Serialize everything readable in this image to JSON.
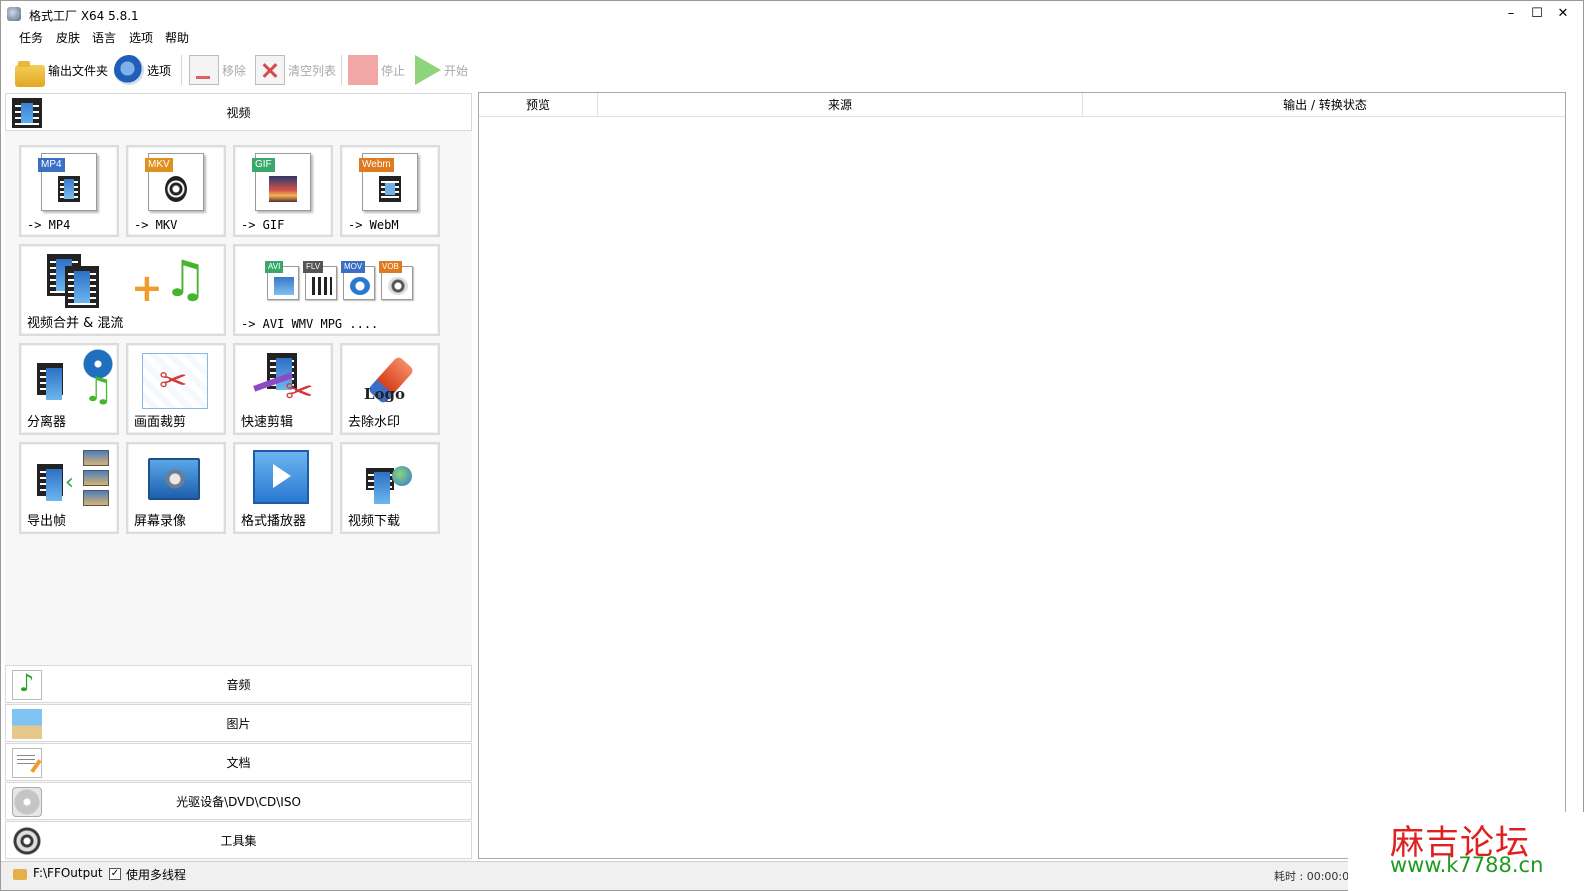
{
  "window": {
    "title": "格式工厂 X64 5.8.1",
    "min_glyph": "–",
    "max_glyph": "☐",
    "close_glyph": "✕"
  },
  "menu": {
    "items": [
      "任务",
      "皮肤",
      "语言",
      "选项",
      "帮助"
    ]
  },
  "toolbar": {
    "output_folder": "输出文件夹",
    "options": "选项",
    "remove": "移除",
    "clear_list": "清空列表",
    "stop": "停止",
    "start": "开始"
  },
  "categories": {
    "video": "视频",
    "audio": "音频",
    "image": "图片",
    "document": "文档",
    "disc": "光驱设备\\DVD\\CD\\ISO",
    "tools": "工具集"
  },
  "tools": {
    "mp4": {
      "label": "-> MP4",
      "tag": "MP4",
      "tag_color": "#3a6fc4"
    },
    "mkv": {
      "label": "-> MKV",
      "tag": "MKV",
      "tag_color": "#e0901f"
    },
    "gif": {
      "label": "-> GIF",
      "tag": "GIF",
      "tag_color": "#3aa86a"
    },
    "webm": {
      "label": "-> WebM",
      "tag": "Webm",
      "tag_color": "#e07a1f"
    },
    "merge": {
      "label": "视频合并 & 混流"
    },
    "formats": {
      "label": "-> AVI WMV MPG ....",
      "tags": [
        "AVI",
        "FLV",
        "MOV",
        "VOB"
      ]
    },
    "demuxer": {
      "label": "分离器"
    },
    "crop": {
      "label": "画面裁剪"
    },
    "quick_clip": {
      "label": "快速剪辑"
    },
    "remove_watermark": {
      "label": "去除水印",
      "logo_text": "Logo"
    },
    "export_frames": {
      "label": "导出帧"
    },
    "screen_record": {
      "label": "屏幕录像"
    },
    "player": {
      "label": "格式播放器"
    },
    "download": {
      "label": "视频下载"
    }
  },
  "file_list": {
    "columns": [
      "预览",
      "来源",
      "输出 / 转换状态"
    ]
  },
  "statusbar": {
    "output_path": "F:\\FFOutput",
    "multithread_label": "使用多线程",
    "multithread_checked": "✓",
    "elapsed": "耗时 : 00:00:00"
  },
  "watermark": {
    "title": "麻吉论坛",
    "url": "www.k7788.cn"
  },
  "colors": {
    "accent_blue": "#2a78d0",
    "stop_red": "#f2a6a6",
    "start_green": "#8ed47d"
  }
}
